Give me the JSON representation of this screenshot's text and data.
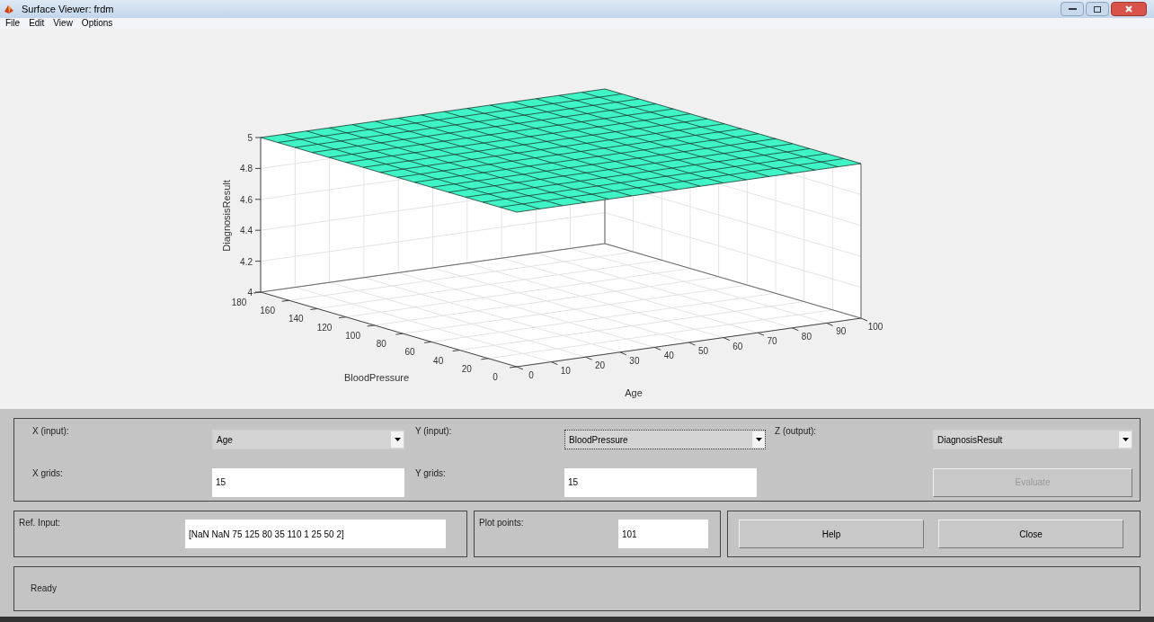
{
  "window": {
    "title": "Surface Viewer: frdm"
  },
  "menu": [
    "File",
    "Edit",
    "View",
    "Options"
  ],
  "plot": {
    "z_label": "DiagnosisResult",
    "x_label": "Age",
    "y_label": "BloodPressure",
    "z_ticks": [
      "5",
      "4.8",
      "4.6",
      "4.4",
      "4.2",
      "4"
    ],
    "x_ticks": [
      "0",
      "10",
      "20",
      "30",
      "40",
      "50",
      "60",
      "70",
      "80",
      "90",
      "100"
    ],
    "y_ticks": [
      "0",
      "20",
      "40",
      "60",
      "80",
      "100",
      "120",
      "140",
      "160",
      "180"
    ]
  },
  "x_input": {
    "label": "X (input):",
    "value": "Age",
    "focused": false
  },
  "y_input": {
    "label": "Y (input):",
    "value": "BloodPressure",
    "focused": true
  },
  "z_output": {
    "label": "Z (output):",
    "value": "DiagnosisResult",
    "focused": false
  },
  "x_grids": {
    "label": "X grids:",
    "value": "15"
  },
  "y_grids": {
    "label": "Y grids:",
    "value": "15"
  },
  "evaluate": {
    "label": "Evaluate",
    "disabled": true
  },
  "ref_input": {
    "label": "Ref. Input:",
    "value": "[NaN NaN 75 125 80 35 110 1 25 50 2]"
  },
  "plot_points": {
    "label": "Plot points:",
    "value": "101"
  },
  "buttons": [
    {
      "label": "Help",
      "disabled": false
    },
    {
      "label": "Close",
      "disabled": false
    }
  ],
  "status": "Ready"
}
